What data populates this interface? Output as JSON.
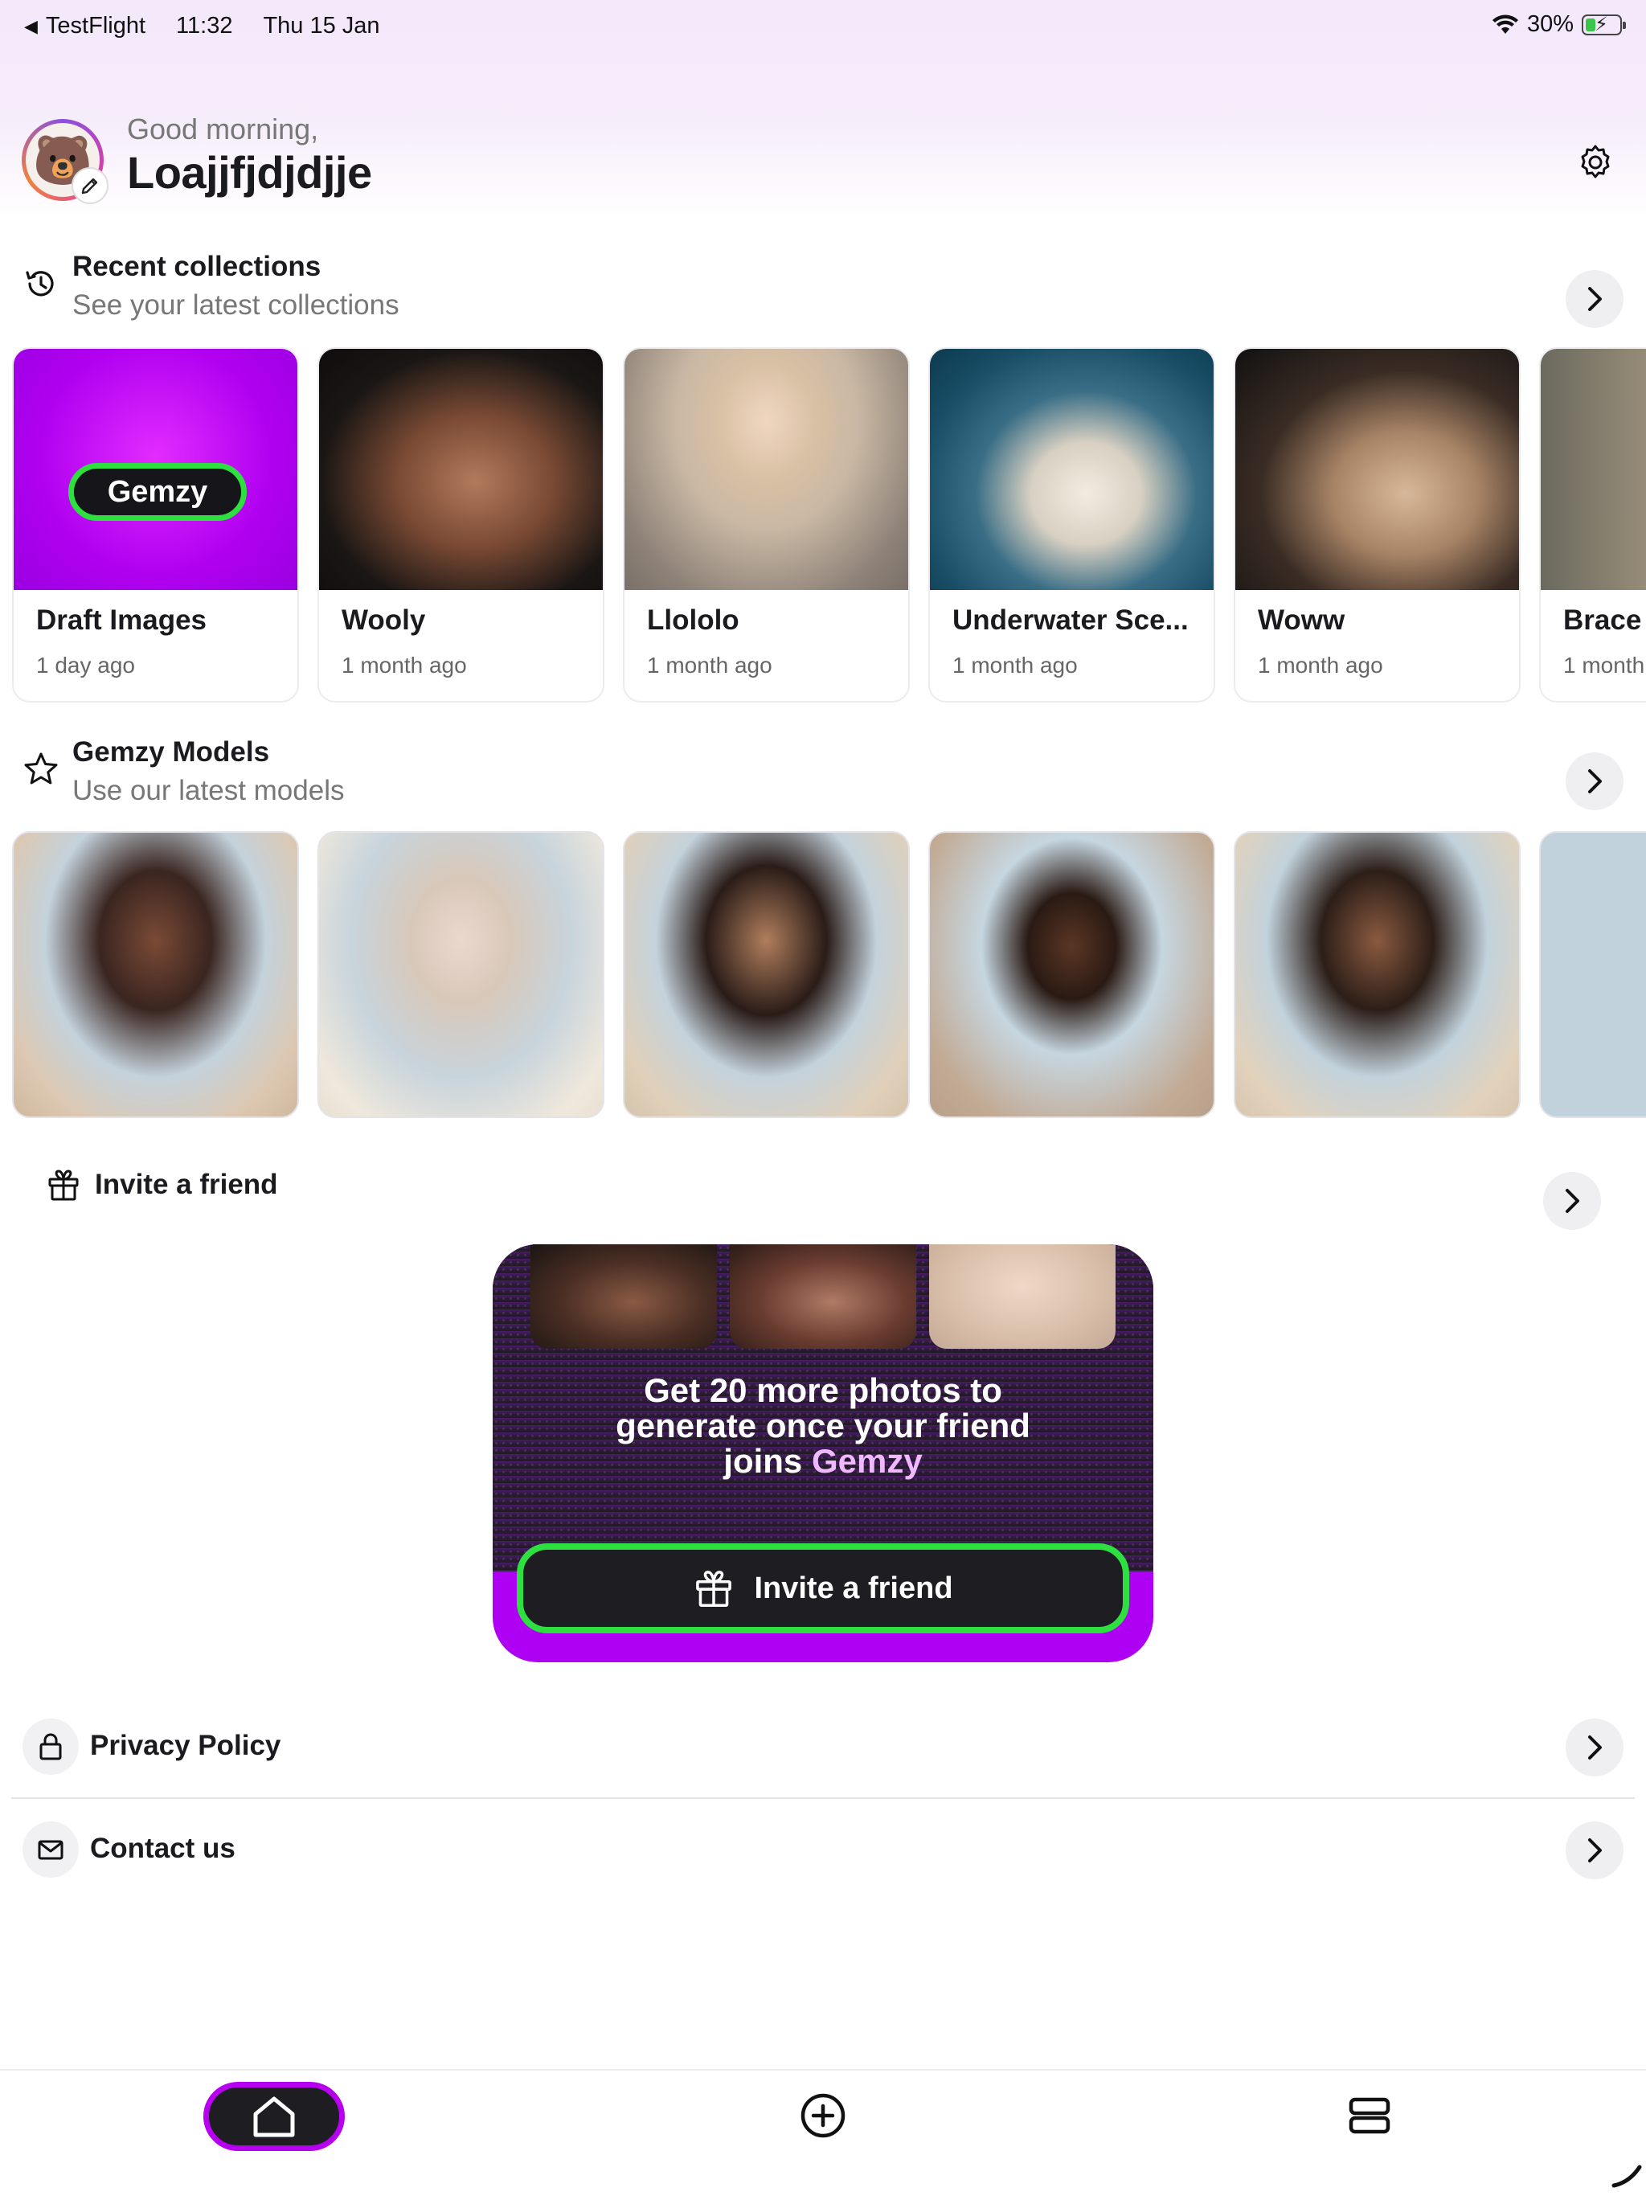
{
  "status_bar": {
    "back_app": "TestFlight",
    "time": "11:32",
    "date": "Thu 15 Jan",
    "battery": "30%"
  },
  "header": {
    "greeting": "Good morning,",
    "username": "Loajjfjdjdjje"
  },
  "recent_collections": {
    "title": "Recent collections",
    "subtitle": "See your latest collections",
    "items": [
      {
        "name": "Draft Images",
        "date": "1 day ago",
        "badge": "Gemzy"
      },
      {
        "name": "Wooly",
        "date": "1 month ago"
      },
      {
        "name": "Llololo",
        "date": "1 month ago"
      },
      {
        "name": "Underwater Sce...",
        "date": "1 month ago"
      },
      {
        "name": "Woww",
        "date": "1 month ago"
      },
      {
        "name": "Brace",
        "date": "1 month"
      }
    ]
  },
  "models": {
    "title": "Gemzy Models",
    "subtitle": "Use our latest models",
    "count_visible": 6
  },
  "invite": {
    "title": "Invite a friend",
    "promo_line1": "Get 20 more photos to",
    "promo_line2": "generate once your friend",
    "promo_line3_prefix": "joins ",
    "promo_brand": "Gemzy",
    "cta_label": "Invite a friend"
  },
  "links": {
    "privacy": "Privacy Policy",
    "contact": "Contact us"
  },
  "tabs": {
    "active": "home"
  },
  "colors": {
    "accent_purple": "#ae00f2",
    "accent_green": "#2de040",
    "dark": "#1d1d22"
  }
}
